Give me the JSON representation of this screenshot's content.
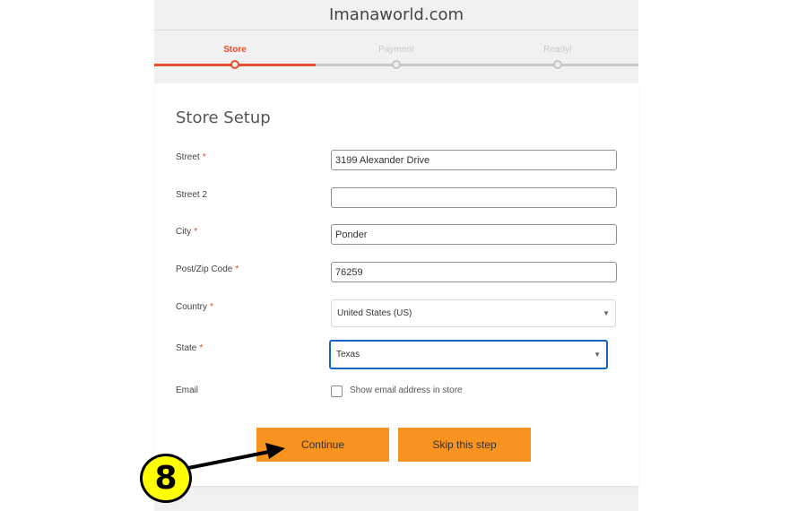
{
  "site": {
    "title": "Imanaworld.com"
  },
  "steps": [
    {
      "label": "Store",
      "active": true
    },
    {
      "label": "Payment",
      "active": false
    },
    {
      "label": "Ready!",
      "active": false
    }
  ],
  "form": {
    "title": "Store Setup",
    "required_mark": "*",
    "street": {
      "label": "Street",
      "value": "3199 Alexander Drive"
    },
    "street2": {
      "label": "Street 2",
      "value": ""
    },
    "city": {
      "label": "City",
      "value": "Ponder"
    },
    "postcode": {
      "label": "Post/Zip Code",
      "value": "76259"
    },
    "country": {
      "label": "Country",
      "value": "United States (US)"
    },
    "state": {
      "label": "State",
      "value": "Texas"
    },
    "email": {
      "label": "Email",
      "checkbox_label": "Show email address in store",
      "checked": false
    }
  },
  "buttons": {
    "continue": "Continue",
    "skip": "Skip this step"
  },
  "annotation": {
    "step_number": "8"
  },
  "colors": {
    "accent": "#e94e2f",
    "button": "#f7931e",
    "focus": "#1565c0",
    "badge": "#ffff00"
  }
}
